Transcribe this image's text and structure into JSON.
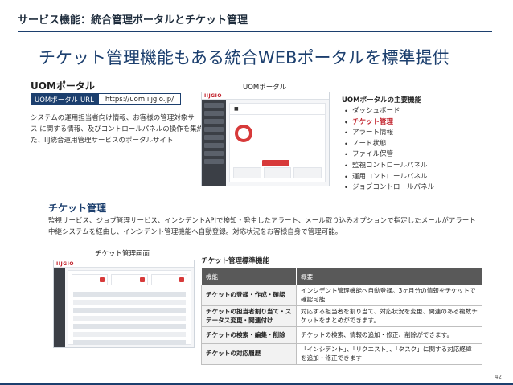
{
  "header": {
    "title": "サービス機能：統合管理ポータルとチケット管理"
  },
  "headline": "チケット管理機能もある統合WEBポータルを標準提供",
  "uom": {
    "title": "UOMポータル",
    "url_label": "UOMポータル URL",
    "url_value": "https://uom.iijgio.jp/",
    "description": "システムの運用担当者向け情報、お客様の管理対象サービス に関する情報、及びコントロールパネルの操作を集約した、IIJ統合運用管理サービスのポータルサイト"
  },
  "portal_screenshot": {
    "caption": "UOMポータル",
    "logo": "IIJGIO"
  },
  "features": {
    "title": "UOMポータルの主要機能",
    "items": [
      {
        "label": "ダッシュボード",
        "active": false
      },
      {
        "label": "チケット管理",
        "active": true
      },
      {
        "label": "アラート情報",
        "active": false
      },
      {
        "label": "ノード状態",
        "active": false
      },
      {
        "label": "ファイル保管",
        "active": false
      },
      {
        "label": "監視コントロールパネル",
        "active": false
      },
      {
        "label": "運用コントロールパネル",
        "active": false
      },
      {
        "label": "ジョブコントロールパネル",
        "active": false
      }
    ],
    "bullet": "•"
  },
  "ticket": {
    "title": "チケット管理",
    "description": "監視サービス、ジョブ管理サービス、インシデントAPIで検知・発生したアラート、メール取り込みオプションで指定したメールがアラート中継システムを経由し、インシデント管理機能へ自動登録。対応状況をお客様自身で管理可能。"
  },
  "ticket_screenshot": {
    "caption": "チケット管理画面",
    "logo": "IIJGIO"
  },
  "standard_table": {
    "title": "チケット管理標準機能",
    "headers": [
      "機能",
      "概要"
    ],
    "rows": [
      [
        "チケットの登録・作成・確認",
        "インシデント管理機能へ自動登録。3ヶ月分の情報をチケットで確認可能"
      ],
      [
        "チケットの担当者割り当て・ステータス変更・関連付け",
        "対応する担当者を割り当て、対応状況を変更、関連のある複数チケットをまとめができます。"
      ],
      [
        "チケットの検索・編集・削除",
        "チケットの検索、情報の追加・修正、削除ができます。"
      ],
      [
        "チケットの対応履歴",
        "「インシデント」、「リクエスト」、「タスク」に関する対応経緯を追加・修正できます"
      ]
    ]
  },
  "page_number": "42"
}
